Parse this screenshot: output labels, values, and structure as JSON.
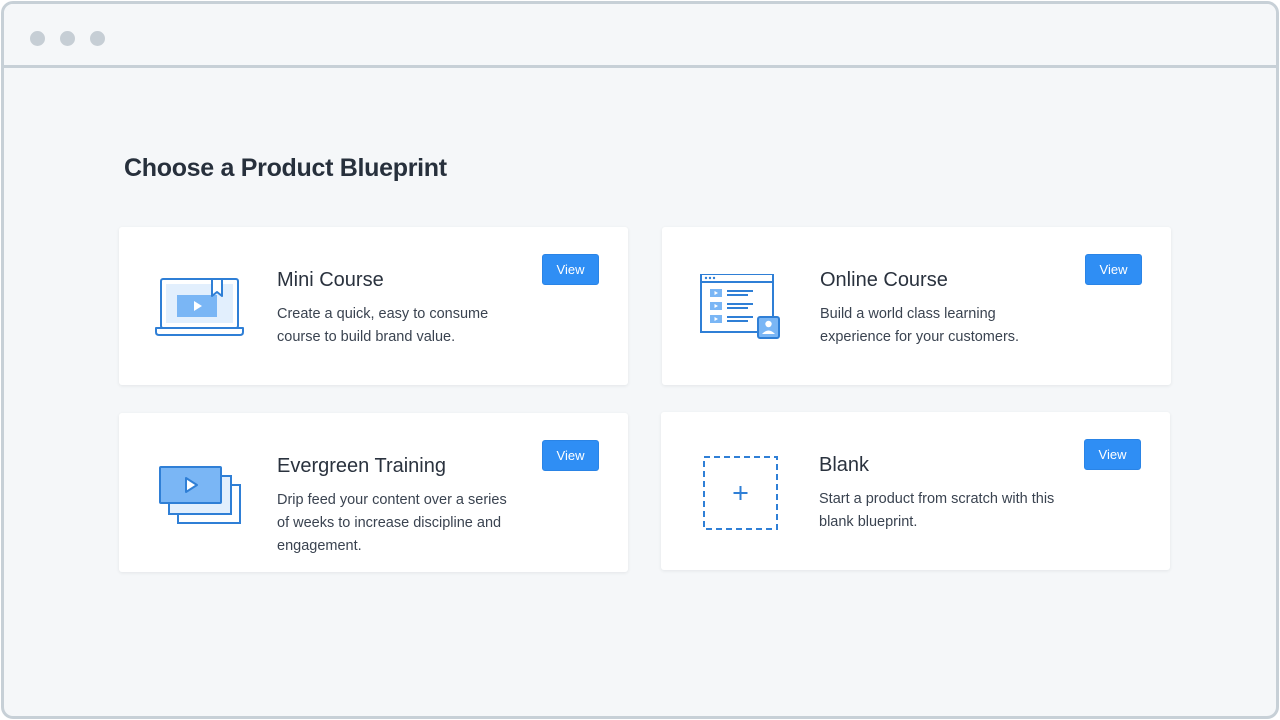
{
  "page": {
    "title": "Choose a Product Blueprint"
  },
  "colors": {
    "accent": "#2f8ef4",
    "icon_stroke": "#2f7fd6",
    "icon_fill": "#7ab6f5"
  },
  "blueprints": [
    {
      "icon": "laptop-video-icon",
      "title": "Mini Course",
      "description": "Create a quick, easy to consume course to build brand value.",
      "button": "View"
    },
    {
      "icon": "course-lessons-icon",
      "title": "Online Course",
      "description": "Build a world class learning experience for your customers.",
      "button": "View"
    },
    {
      "icon": "stacked-videos-icon",
      "title": "Evergreen Training",
      "description": "Drip feed your content over a series of weeks to increase discipline and engagement.",
      "button": "View"
    },
    {
      "icon": "plus-icon",
      "title": "Blank",
      "description": "Start a product from scratch with this blank blueprint.",
      "button": "View"
    }
  ]
}
